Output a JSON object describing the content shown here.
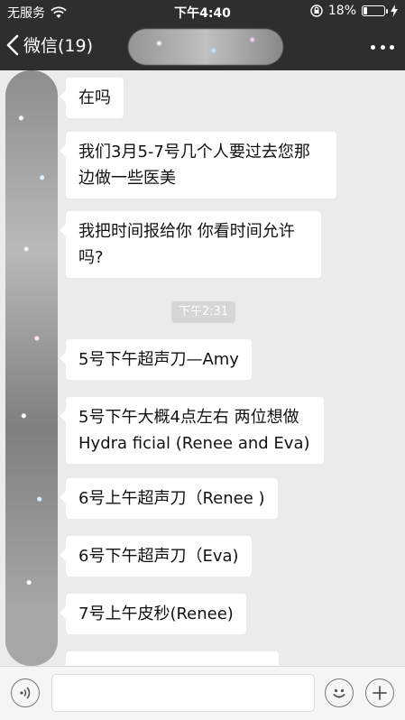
{
  "status_bar": {
    "carrier": "无服务",
    "time": "下午4:40",
    "battery": "18%",
    "battery_level": 0.18
  },
  "nav": {
    "back_label": "微信(19)"
  },
  "messages": [
    {
      "text": "在吗"
    },
    {
      "text": "我们3月5-7号几个人要过去您那边做一些医美"
    },
    {
      "text": "我把时间报给你 你看时间允许吗?"
    },
    {
      "text": "5号下午超声刀—Amy"
    },
    {
      "text": "5号下午大概4点左右 两位想做Hydra ficial (Renee and Eva)"
    },
    {
      "text": "6号上午超声刀（Renee )"
    },
    {
      "text": "6号下午超声刀（Eva)"
    },
    {
      "text": "7号上午皮秒(Renee)"
    }
  ],
  "timestamp": "下午2:31",
  "icons": {
    "wifi": "wifi-icon",
    "back": "chevron-left-icon",
    "more": "more-dots-icon",
    "voice": "voice-icon",
    "emoji": "emoji-icon",
    "plus": "plus-icon"
  }
}
